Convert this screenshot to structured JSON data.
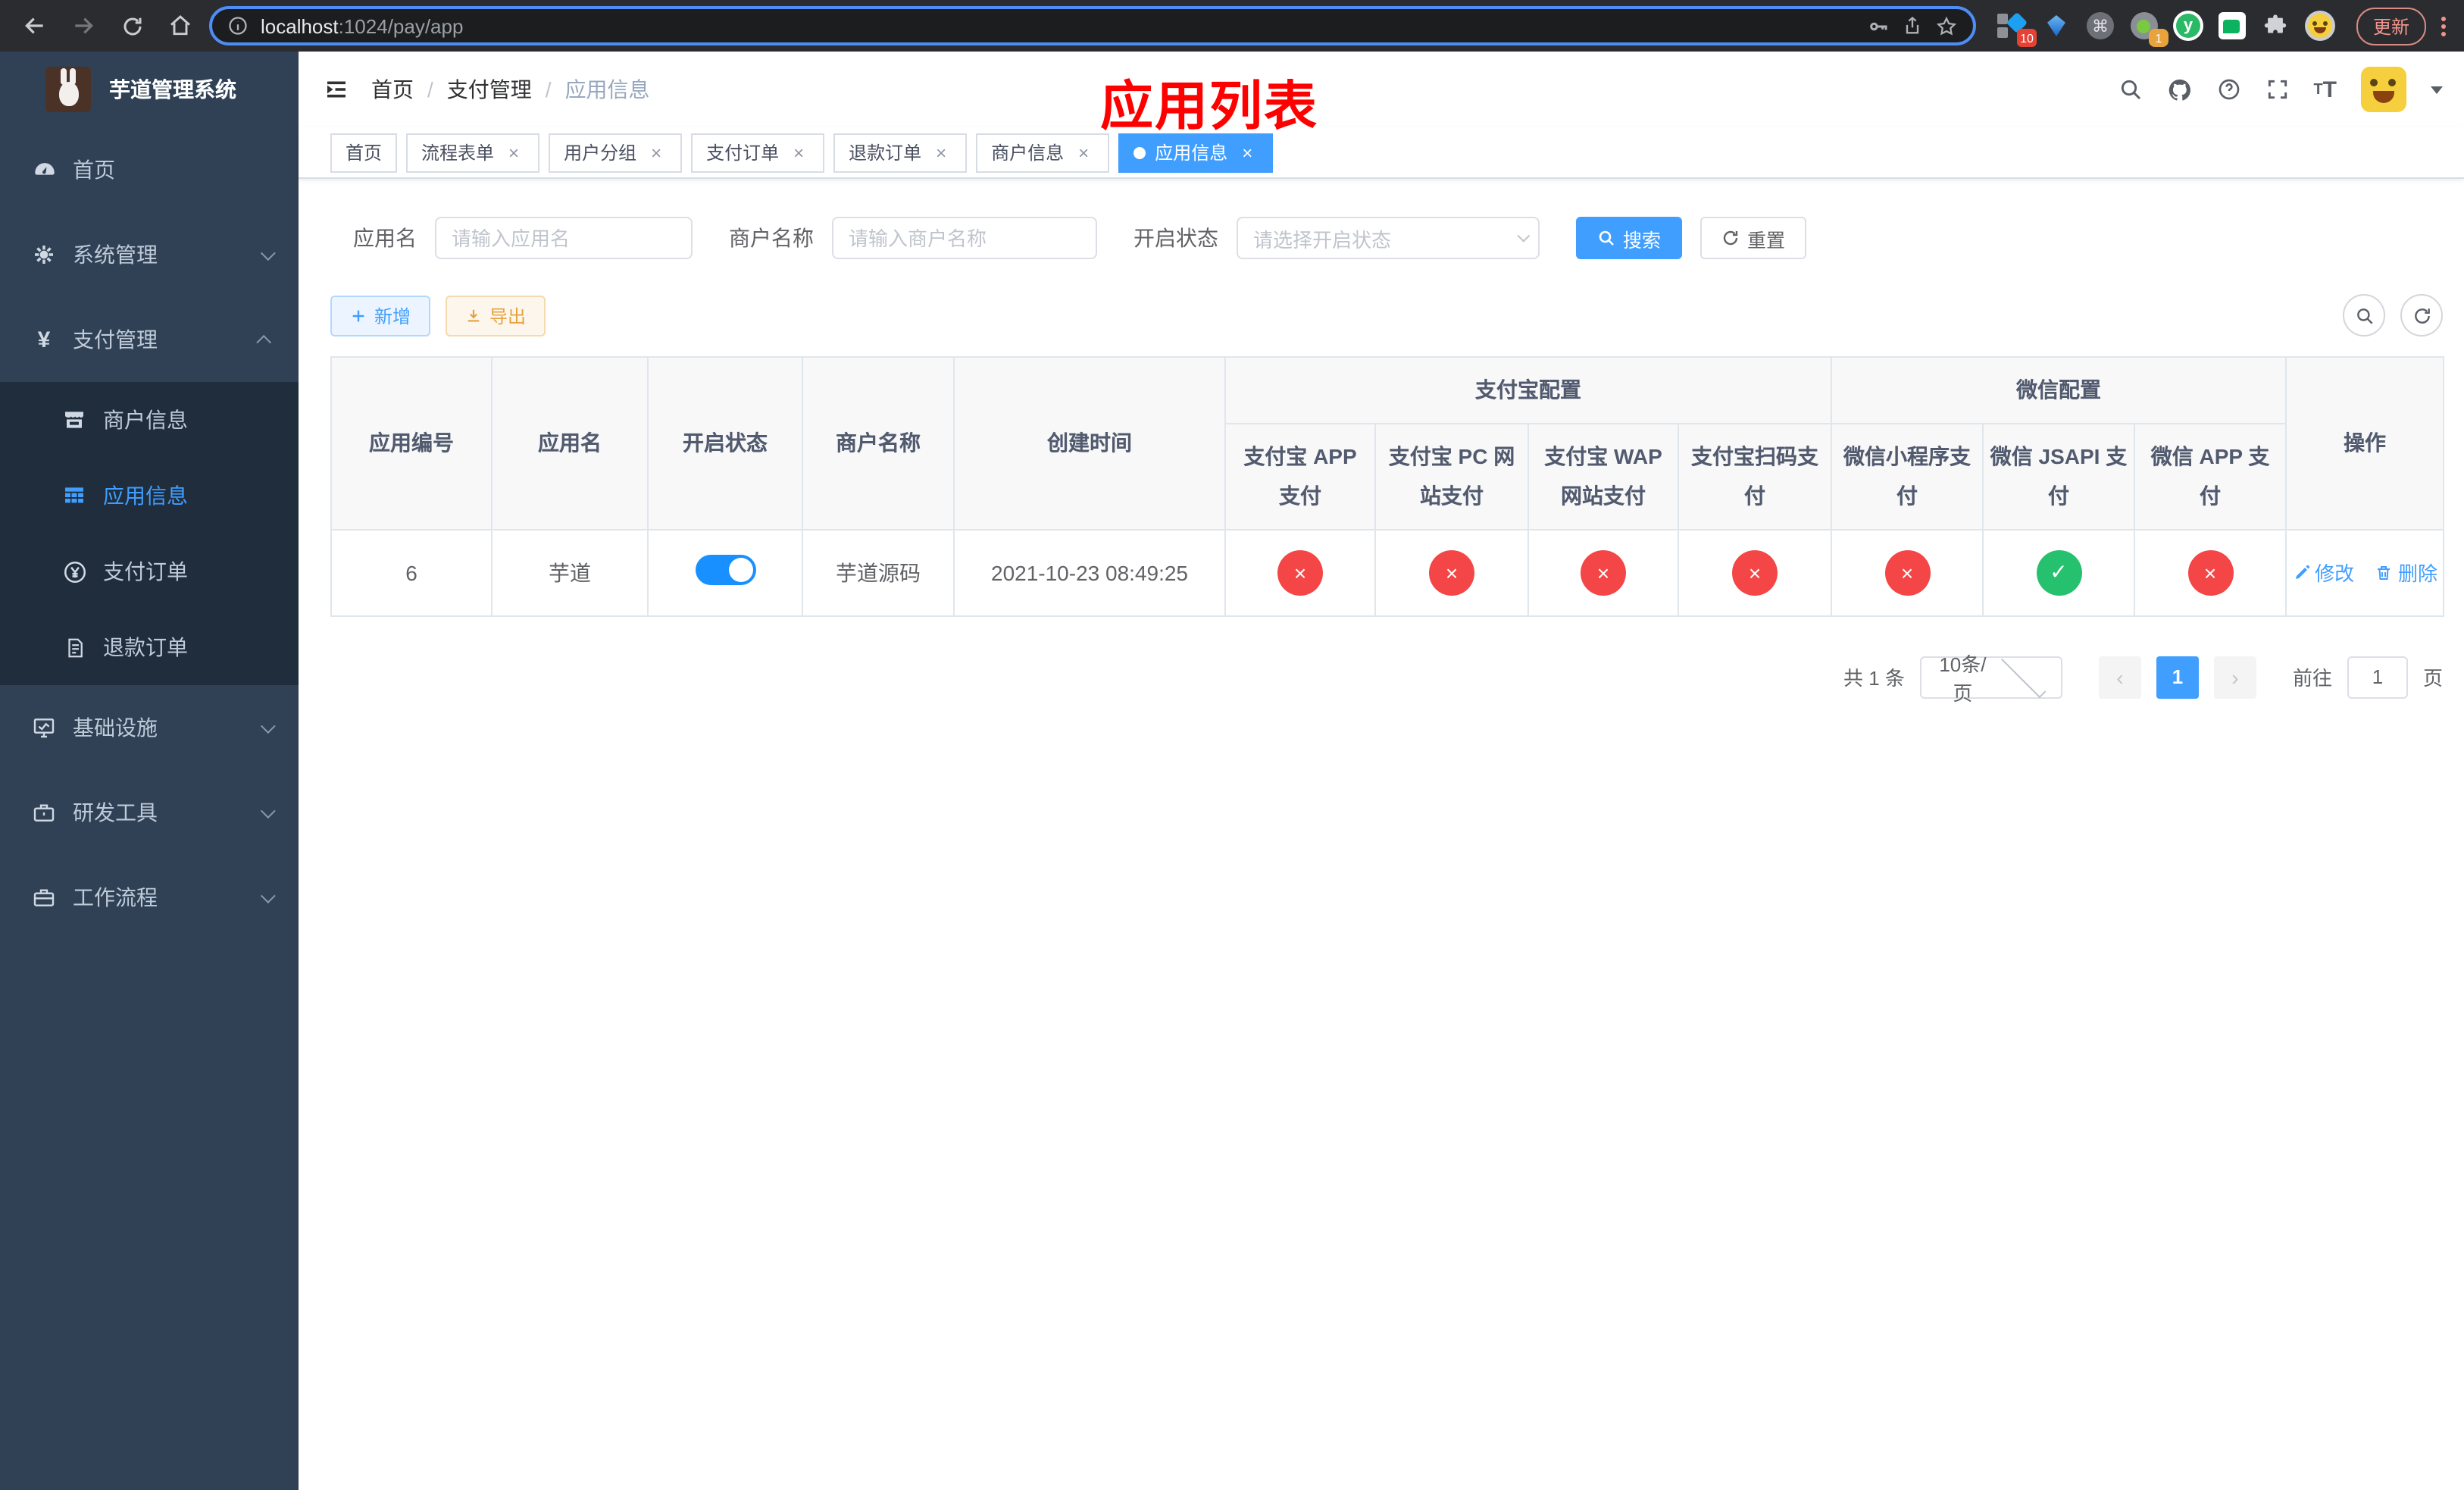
{
  "browser": {
    "url": {
      "host": "localhost",
      "path": ":1024/pay/app"
    },
    "update_button": "更新",
    "ext_badge_blue_diamond": "10",
    "ext_badge_target": "1",
    "ext_y_glyph": "y",
    "command_glyph": "⌘"
  },
  "sidebar": {
    "title": "芋道管理系统",
    "menu": {
      "home": "首页",
      "system": "系统管理",
      "payment": "支付管理",
      "merchant": "商户信息",
      "app": "应用信息",
      "pay_order": "支付订单",
      "refund_order": "退款订单",
      "infra": "基础设施",
      "devtools": "研发工具",
      "workflow": "工作流程"
    },
    "payment_icon_glyph": "¥"
  },
  "breadcrumb": {
    "items": [
      "首页",
      "支付管理",
      "应用信息"
    ],
    "separator": "/"
  },
  "page_annotation": "应用列表",
  "header_icons": {
    "question_glyph": "?",
    "font_big": "T",
    "font_small": "T"
  },
  "tabs": [
    {
      "label": "首页",
      "closable": "false",
      "active": "false"
    },
    {
      "label": "流程表单",
      "closable": "true",
      "active": "false"
    },
    {
      "label": "用户分组",
      "closable": "true",
      "active": "false"
    },
    {
      "label": "支付订单",
      "closable": "true",
      "active": "false"
    },
    {
      "label": "退款订单",
      "closable": "true",
      "active": "false"
    },
    {
      "label": "商户信息",
      "closable": "true",
      "active": "false"
    },
    {
      "label": "应用信息",
      "closable": "true",
      "active": "true"
    }
  ],
  "tab_close_glyph": "×",
  "filters": {
    "app_name": {
      "label": "应用名",
      "placeholder": "请输入应用名"
    },
    "merchant_name": {
      "label": "商户名称",
      "placeholder": "请输入商户名称"
    },
    "status": {
      "label": "开启状态",
      "placeholder": "请选择开启状态"
    },
    "search": "搜索",
    "reset": "重置"
  },
  "toolbar": {
    "add": "新增",
    "export": "导出"
  },
  "table": {
    "columns": {
      "app_id": "应用编号",
      "app_name": "应用名",
      "status": "开启状态",
      "merchant": "商户名称",
      "created": "创建时间",
      "actions": "操作"
    },
    "groups": {
      "alipay": {
        "label": "支付宝配置",
        "children": [
          "支付宝 APP 支付",
          "支付宝 PC 网站支付",
          "支付宝 WAP 网站支付",
          "支付宝扫码支付"
        ]
      },
      "wechat": {
        "label": "微信配置",
        "children": [
          "微信小程序支付",
          "微信 JSAPI 支付",
          "微信 APP 支付"
        ]
      }
    },
    "row": {
      "app_id": "6",
      "app_name": "芋道",
      "status_on": "true",
      "merchant": "芋道源码",
      "created": "2021-10-23 08:49:25",
      "configs": [
        {
          "state": "fail",
          "glyph": "×"
        },
        {
          "state": "fail",
          "glyph": "×"
        },
        {
          "state": "fail",
          "glyph": "×"
        },
        {
          "state": "fail",
          "glyph": "×"
        },
        {
          "state": "fail",
          "glyph": "×"
        },
        {
          "state": "pass",
          "glyph": "✓"
        },
        {
          "state": "fail",
          "glyph": "×"
        }
      ],
      "edit": "修改",
      "delete": "删除"
    }
  },
  "pagination": {
    "total": "共 1 条",
    "size": "10条/页",
    "prev": "‹",
    "page": "1",
    "next": "›",
    "goto": "前往",
    "goto_value": "1",
    "unit": "页"
  }
}
